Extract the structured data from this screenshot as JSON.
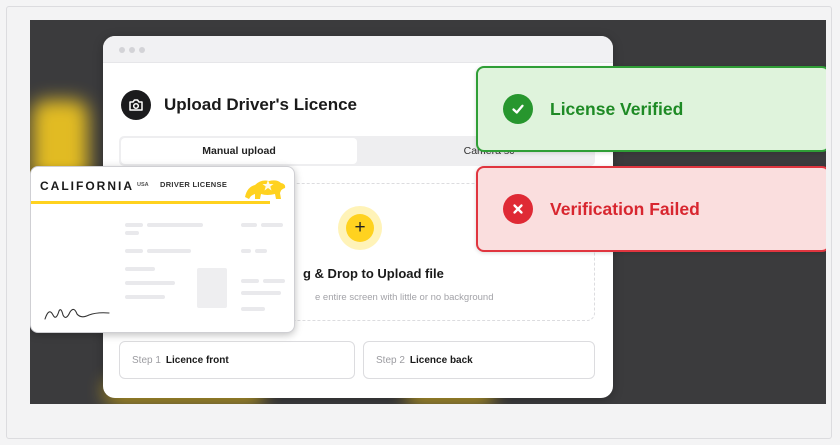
{
  "upload": {
    "title": "Upload Driver's Licence",
    "tabs": [
      {
        "label": "Manual upload",
        "active": true
      },
      {
        "label": "Camera sc",
        "active": false
      }
    ],
    "dropzone": {
      "title": "g & Drop to Upload file",
      "subtitle": "e entire screen with little or no background"
    },
    "steps": [
      {
        "number": "Step 1",
        "label": "Licence front"
      },
      {
        "number": "Step 2",
        "label": "Licence back"
      }
    ]
  },
  "license_card": {
    "state": "CALIFORNIA",
    "country": "USA",
    "type": "DRIVER LICENSE"
  },
  "status": {
    "verified": "License Verified",
    "failed": "Verification Failed"
  },
  "colors": {
    "accent": "#ffd21f",
    "success": "#27962e",
    "error": "#df2a35"
  }
}
